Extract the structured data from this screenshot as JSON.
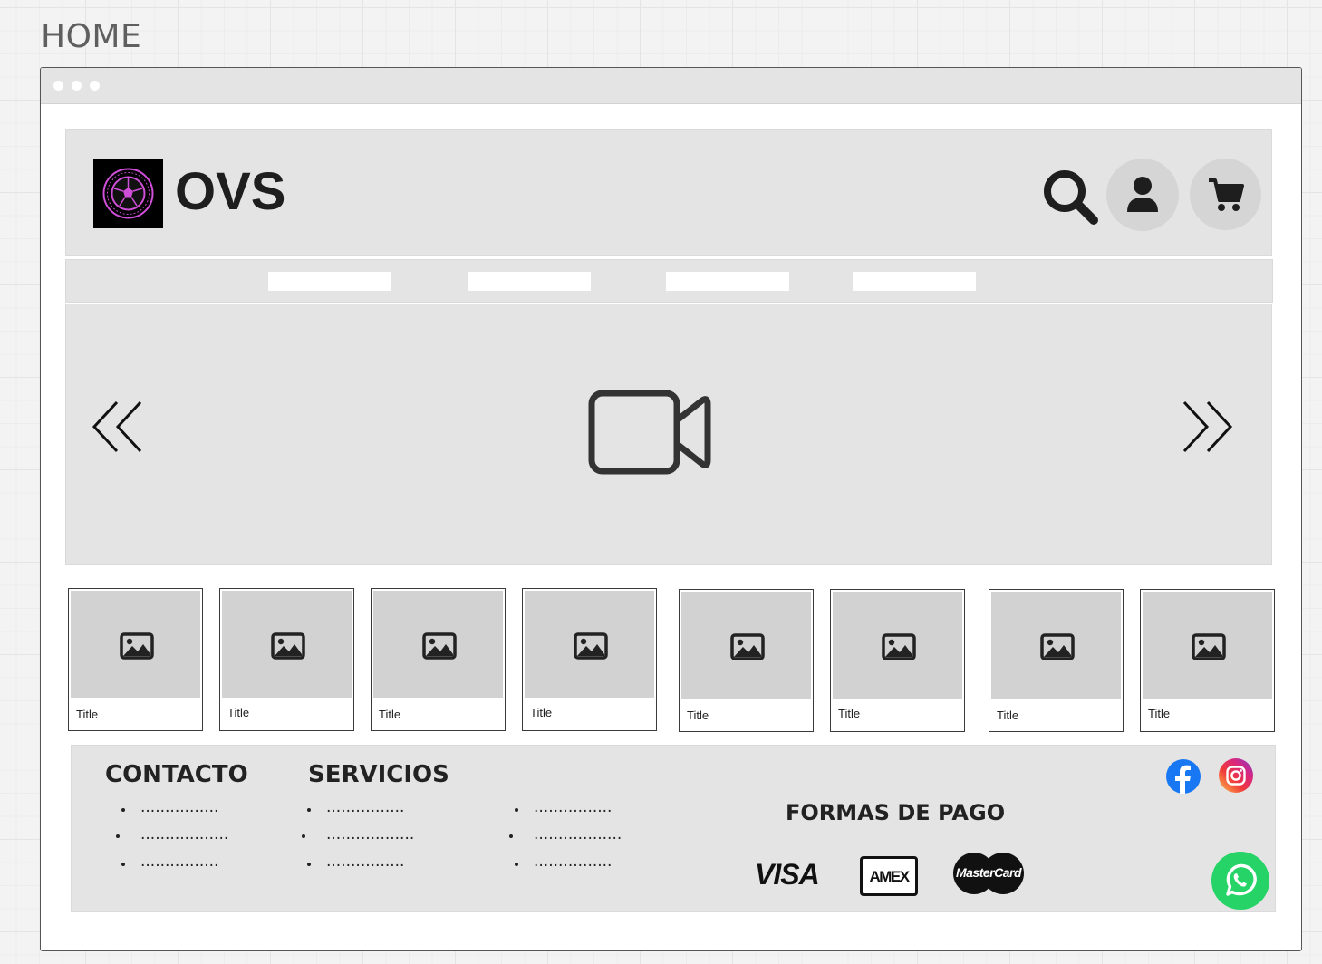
{
  "page": {
    "label": "HOME"
  },
  "header": {
    "brand": "OVS"
  },
  "cards": [
    {
      "title": "Title"
    },
    {
      "title": "Title"
    },
    {
      "title": "Title"
    },
    {
      "title": "Title"
    },
    {
      "title": "Title"
    },
    {
      "title": "Title"
    },
    {
      "title": "Title"
    },
    {
      "title": "Title"
    }
  ],
  "footer": {
    "contacto": {
      "heading": "CONTACTO",
      "items": [
        "................",
        "..................",
        "................"
      ]
    },
    "servicios": {
      "heading": "SERVICIOS",
      "items": [
        "................",
        "..................",
        "................"
      ]
    },
    "extra": {
      "items": [
        "................",
        "..................",
        "................"
      ]
    },
    "formas_de_pago": {
      "heading": "FORMAS DE PAGO",
      "visa": "VISA",
      "amex": "AMEX",
      "mastercard": "MasterCard"
    }
  },
  "icons": {
    "search": "search-icon",
    "user": "user-icon",
    "cart": "cart-icon",
    "prev": "double-chevron-left-icon",
    "next": "double-chevron-right-icon",
    "video": "video-camera-icon",
    "image": "image-icon",
    "facebook": "facebook-icon",
    "instagram": "instagram-icon",
    "whatsapp": "whatsapp-icon"
  },
  "colors": {
    "facebook": "#1877f2",
    "whatsapp": "#25d366",
    "logo_accent": "#d04fd8"
  }
}
